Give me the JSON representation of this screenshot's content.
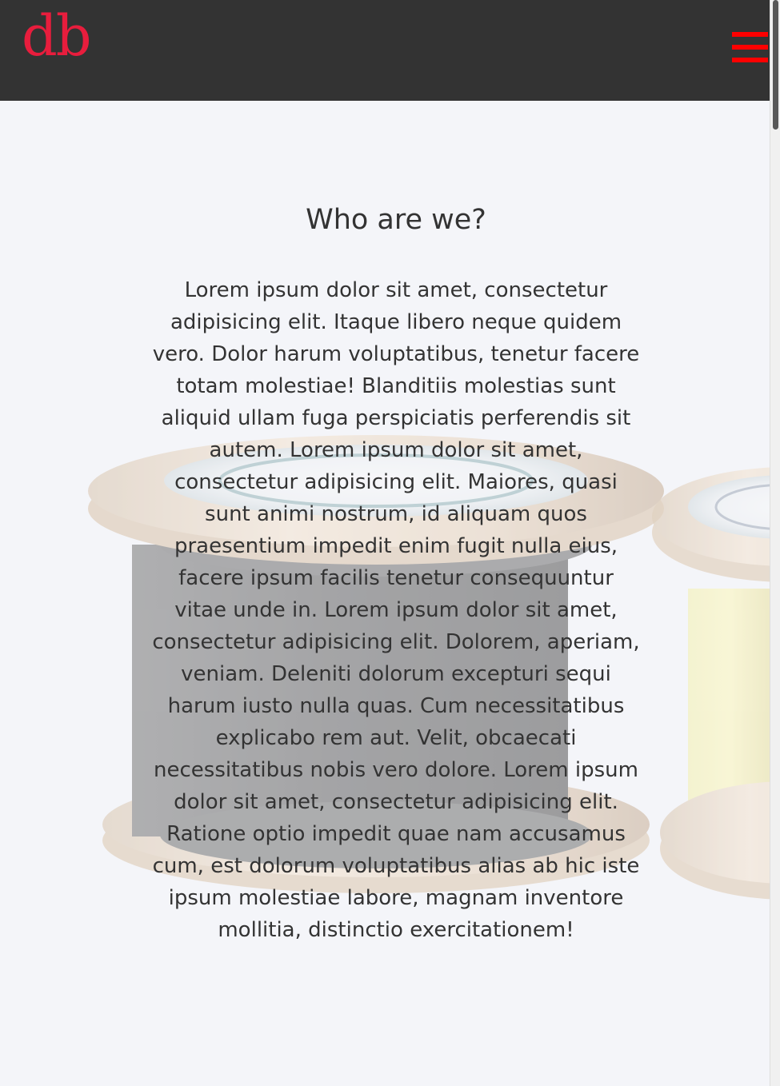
{
  "header": {
    "logo": "db",
    "menu_icon": "hamburger-menu-icon"
  },
  "about": {
    "heading": "Who are we?",
    "body": "Lorem ipsum dolor sit amet, consectetur adipisicing elit. Itaque libero neque quidem vero. Dolor harum voluptatibus, tenetur facere totam molestiae! Blanditiis molestias sunt aliquid ullam fuga perspiciatis perferendis sit autem. Lorem ipsum dolor sit amet, consectetur adipisicing elit. Maiores, quasi sunt animi nostrum, id aliquam quos praesentium impedit enim fugit nulla eius, facere ipsum facilis tenetur consequuntur vitae unde in. Lorem ipsum dolor sit amet, consectetur adipisicing elit. Dolorem, aperiam, veniam. Deleniti dolorum excepturi sequi harum iusto nulla quas. Cum necessitatibus explicabo rem aut. Velit, obcaecati necessitatibus nobis vero dolore. Lorem ipsum dolor sit amet, consectetur adipisicing elit. Ratione optio impedit quae nam accusamus cum, est dolorum voluptatibus alias ab hic iste ipsum molestiae labore, magnam inventore mollitia, distinctio exercitationem!"
  },
  "colors": {
    "header_background": "#333333",
    "brand_red": "#e81d3d",
    "menu_red": "#ff0000",
    "text": "#333333"
  }
}
